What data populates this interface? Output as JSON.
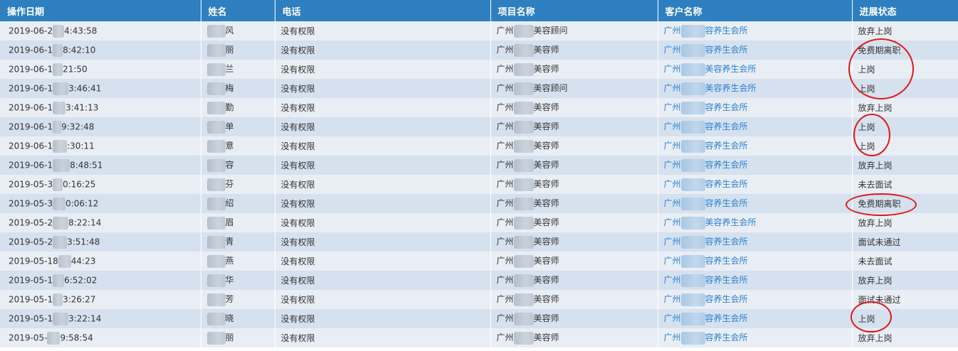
{
  "table": {
    "headers": [
      "操作日期",
      "姓名",
      "电话",
      "项目名称",
      "客户名称",
      "进展状态"
    ],
    "rows": [
      {
        "date_pre": "2019-06-2",
        "date_post": "4:43:58",
        "name": "风",
        "phone": "没有权限",
        "project_pre": "广州",
        "project_post": "美容顾问",
        "customer_pre": "广州",
        "customer_post": "容养生会所",
        "status": "放弃上岗"
      },
      {
        "date_pre": "2019-06-1",
        "date_post": "8:42:10",
        "name": "丽",
        "phone": "没有权限",
        "project_pre": "广州",
        "project_post": "美容师",
        "customer_pre": "广州",
        "customer_post": "容养生会所",
        "status": "免费期离职"
      },
      {
        "date_pre": "2019-06-1",
        "date_post": "21:50",
        "name": "兰",
        "phone": "没有权限",
        "project_pre": "广州",
        "project_post": "美容师",
        "customer_pre": "广州",
        "customer_post": "美容养生会所",
        "status": "上岗"
      },
      {
        "date_pre": "2019-06-1",
        "date_post": "3:46:41",
        "name": "梅",
        "phone": "没有权限",
        "project_pre": "广州",
        "project_post": "美容顾问",
        "customer_pre": "广州",
        "customer_post": "美容养生会所",
        "status": "上岗"
      },
      {
        "date_pre": "2019-06-1",
        "date_post": "3:41:13",
        "name": "勤",
        "phone": "没有权限",
        "project_pre": "广州",
        "project_post": "美容师",
        "customer_pre": "广州",
        "customer_post": "容养生会所",
        "status": "放弃上岗"
      },
      {
        "date_pre": "2019-06-1",
        "date_post": "9:32:48",
        "name": "单",
        "phone": "没有权限",
        "project_pre": "广州",
        "project_post": "美容师",
        "customer_pre": "广州",
        "customer_post": "容养生会所",
        "status": "上岗"
      },
      {
        "date_pre": "2019-06-1",
        "date_post": ":30:11",
        "name": "意",
        "phone": "没有权限",
        "project_pre": "广州",
        "project_post": "美容师",
        "customer_pre": "广州",
        "customer_post": "容养生会所",
        "status": "上岗"
      },
      {
        "date_pre": "2019-06-1",
        "date_post": "8:48:51",
        "name": "容",
        "phone": "没有权限",
        "project_pre": "广州",
        "project_post": "美容师",
        "customer_pre": "广州",
        "customer_post": "容养生会所",
        "status": "放弃上岗"
      },
      {
        "date_pre": "2019-05-3",
        "date_post": "0:16:25",
        "name": "芬",
        "phone": "没有权限",
        "project_pre": "广州",
        "project_post": "美容师",
        "customer_pre": "广州",
        "customer_post": "容养生会所",
        "status": "未去面试"
      },
      {
        "date_pre": "2019-05-3",
        "date_post": "0:06:12",
        "name": "绍",
        "phone": "没有权限",
        "project_pre": "广州",
        "project_post": "美容师",
        "customer_pre": "广州",
        "customer_post": "容养生会所",
        "status": "免费期离职"
      },
      {
        "date_pre": "2019-05-2",
        "date_post": "8:22:14",
        "name": "眉",
        "phone": "没有权限",
        "project_pre": "广州",
        "project_post": "美容师",
        "customer_pre": "广州",
        "customer_post": "美容养生会所",
        "status": "放弃上岗"
      },
      {
        "date_pre": "2019-05-2",
        "date_post": "3:51:48",
        "name": "青",
        "phone": "没有权限",
        "project_pre": "广州",
        "project_post": "美容师",
        "customer_pre": "广州",
        "customer_post": "容养生会所",
        "status": "面试未通过"
      },
      {
        "date_pre": "2019-05-18",
        "date_post": "44:23",
        "name": "燕",
        "phone": "没有权限",
        "project_pre": "广州",
        "project_post": "美容师",
        "customer_pre": "广州",
        "customer_post": "容养生会所",
        "status": "未去面试"
      },
      {
        "date_pre": "2019-05-1",
        "date_post": "6:52:02",
        "name": "华",
        "phone": "没有权限",
        "project_pre": "广州",
        "project_post": "美容师",
        "customer_pre": "广州",
        "customer_post": "容养生会所",
        "status": "放弃上岗"
      },
      {
        "date_pre": "2019-05-1",
        "date_post": "3:26:27",
        "name": "芳",
        "phone": "没有权限",
        "project_pre": "广州",
        "project_post": "美容师",
        "customer_pre": "广州",
        "customer_post": "容养生会所",
        "status": "面试未通过"
      },
      {
        "date_pre": "2019-05-1",
        "date_post": "3:22:14",
        "name": "晓",
        "phone": "没有权限",
        "project_pre": "广州",
        "project_post": "美容师",
        "customer_pre": "广州",
        "customer_post": "容养生会所",
        "status": "上岗"
      },
      {
        "date_pre": "2019-05-",
        "date_post": "9:58:54",
        "name": "丽",
        "phone": "没有权限",
        "project_pre": "广州",
        "project_post": "美容师",
        "customer_pre": "广州",
        "customer_post": "容养生会所",
        "status": "放弃上岗"
      }
    ]
  },
  "colors": {
    "header_bg": "#2e7fbf",
    "row_odd": "#e9eef5",
    "row_even": "#d5e1ef",
    "link": "#2b7fd0",
    "annotation": "#e01818"
  }
}
